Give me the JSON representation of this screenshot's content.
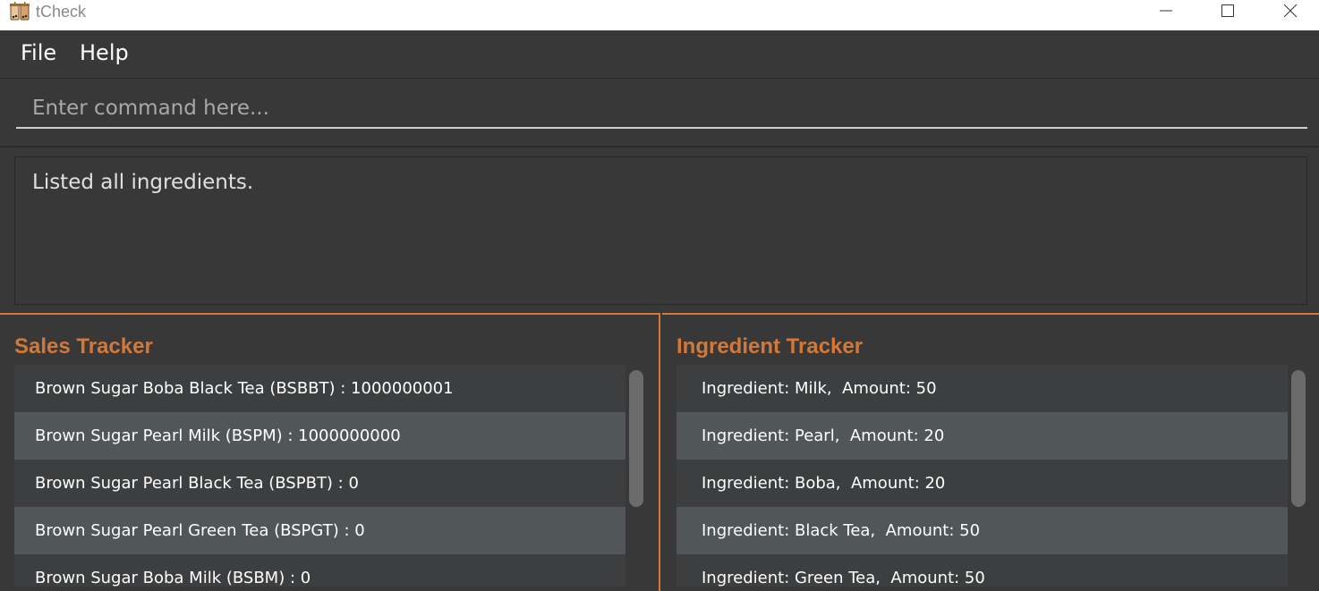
{
  "window": {
    "title": "tCheck",
    "icon": "bubble-tea-icon"
  },
  "menu": {
    "file_label": "File",
    "help_label": "Help"
  },
  "command": {
    "placeholder": "Enter command here..."
  },
  "result": {
    "message": "Listed all ingredients."
  },
  "sales": {
    "title": "Sales Tracker",
    "items": [
      "Brown Sugar Boba Black Tea (BSBBT) : 1000000001",
      "Brown Sugar Pearl Milk (BSPM) : 1000000000",
      "Brown Sugar Pearl Black Tea (BSPBT) : 0",
      "Brown Sugar Pearl Green Tea (BSPGT) : 0",
      "Brown Sugar Boba Milk (BSBM) : 0"
    ]
  },
  "ingredients": {
    "title": "Ingredient Tracker",
    "items": [
      "Ingredient: Milk,  Amount: 50",
      "Ingredient: Pearl,  Amount: 20",
      "Ingredient: Boba,  Amount: 20",
      "Ingredient: Black Tea,  Amount: 50",
      "Ingredient: Green Tea,  Amount: 50"
    ]
  },
  "colors": {
    "accent": "#d1793a",
    "background": "#383838",
    "row_alt": "#515658"
  }
}
